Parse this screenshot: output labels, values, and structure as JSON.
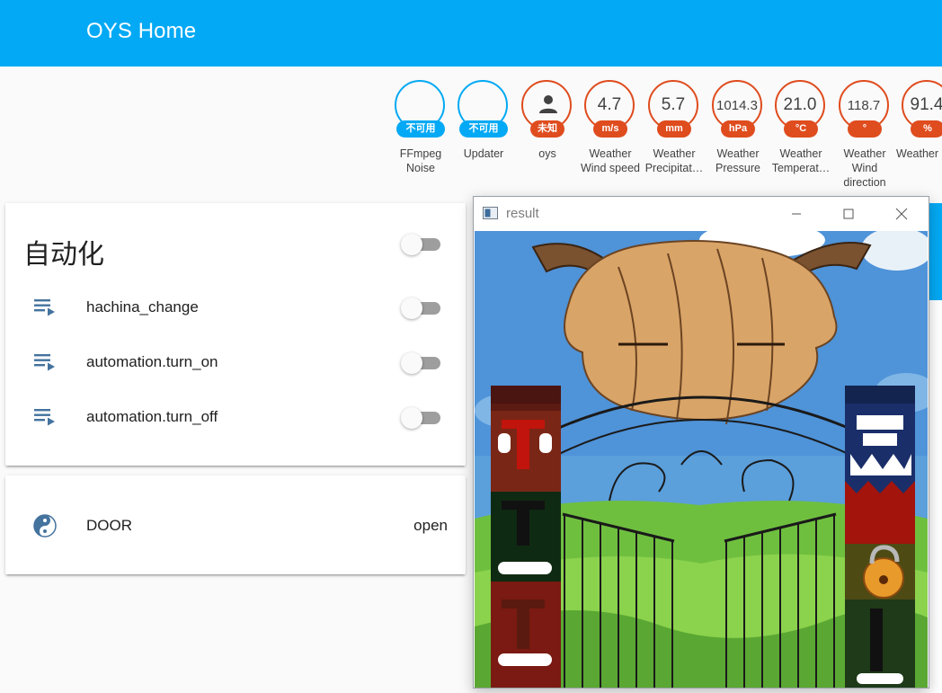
{
  "header": {
    "title": "OYS Home"
  },
  "badges": [
    {
      "value": "",
      "unit": "不可用",
      "label": "FFmpeg Noise",
      "style": "blue"
    },
    {
      "value": "",
      "unit": "不可用",
      "label": "Updater",
      "style": "blue"
    },
    {
      "value": "",
      "unit": "未知",
      "label": "oys",
      "style": "red",
      "icon": "person-icon"
    },
    {
      "value": "4.7",
      "unit": "m/s",
      "label": "Weather Wind speed",
      "style": "red"
    },
    {
      "value": "5.7",
      "unit": "mm",
      "label": "Weather Precipitat…",
      "style": "red"
    },
    {
      "value": "1014.3",
      "unit": "hPa",
      "label": "Weather Pressure",
      "style": "red"
    },
    {
      "value": "21.0",
      "unit": "°C",
      "label": "Weather Temperat…",
      "style": "red"
    },
    {
      "value": "118.7",
      "unit": "°",
      "label": "Weather Wind direction",
      "style": "red"
    },
    {
      "value": "91.4",
      "unit": "%",
      "label": "Weather Humidity",
      "style": "red"
    }
  ],
  "automation_card": {
    "title": "自动化",
    "items": [
      {
        "label": "hachina_change",
        "icon": "playlist-play-icon",
        "on": false
      },
      {
        "label": "automation.turn_on",
        "icon": "playlist-play-icon",
        "on": false
      },
      {
        "label": "automation.turn_off",
        "icon": "playlist-play-icon",
        "on": false
      }
    ]
  },
  "door_card": {
    "label": "DOOR",
    "state": "open",
    "icon": "yin-yang-icon"
  },
  "window": {
    "title": "result",
    "minimize_icon": "minimize-icon",
    "maximize_icon": "maximize-icon",
    "close_icon": "close-icon"
  },
  "colors": {
    "primary": "#03a9f4",
    "badge_red": "#df4c1e",
    "icon_blue": "#44739e"
  }
}
